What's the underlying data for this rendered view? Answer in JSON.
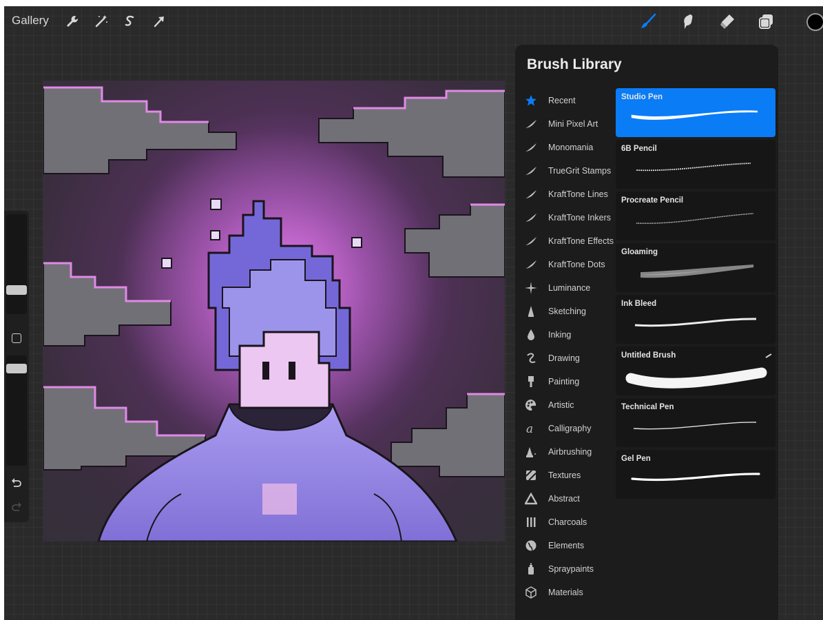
{
  "topbar": {
    "gallery_label": "Gallery",
    "left_tools": [
      {
        "name": "wrench-icon"
      },
      {
        "name": "magic-wand-icon"
      },
      {
        "name": "selection-icon"
      },
      {
        "name": "transform-arrow-icon"
      }
    ],
    "right_tools": [
      {
        "name": "brush-icon",
        "active": true
      },
      {
        "name": "smudge-icon"
      },
      {
        "name": "eraser-icon"
      },
      {
        "name": "layers-icon"
      }
    ],
    "current_color": "#000000",
    "accent_color": "#0a7cf6"
  },
  "sidebar": {
    "brush_size_level": 0.25,
    "opacity_level": 0.65,
    "items": [
      {
        "name": "brush-size-slider"
      },
      {
        "name": "modifier-button"
      },
      {
        "name": "opacity-slider"
      },
      {
        "name": "undo-icon"
      },
      {
        "name": "redo-icon"
      }
    ]
  },
  "brush_library": {
    "title": "Brush Library",
    "sets": [
      {
        "label": "Recent",
        "icon": "star-icon"
      },
      {
        "label": "Mini Pixel Art",
        "icon": "brush-stroke-icon"
      },
      {
        "label": "Monomania",
        "icon": "brush-stroke-icon"
      },
      {
        "label": "TrueGrit Stamps",
        "icon": "brush-stroke-icon"
      },
      {
        "label": "KraftTone Lines",
        "icon": "brush-stroke-icon"
      },
      {
        "label": "KraftTone Inkers",
        "icon": "brush-stroke-icon"
      },
      {
        "label": "KraftTone Effects",
        "icon": "brush-stroke-icon"
      },
      {
        "label": "KraftTone Dots",
        "icon": "brush-stroke-icon"
      },
      {
        "label": "Luminance",
        "icon": "sparkle-icon"
      },
      {
        "label": "Sketching",
        "icon": "pencil-tip-icon"
      },
      {
        "label": "Inking",
        "icon": "ink-drop-icon"
      },
      {
        "label": "Drawing",
        "icon": "squiggle-icon"
      },
      {
        "label": "Painting",
        "icon": "paintbrush-icon"
      },
      {
        "label": "Artistic",
        "icon": "palette-icon"
      },
      {
        "label": "Calligraphy",
        "icon": "calligraphy-icon"
      },
      {
        "label": "Airbrushing",
        "icon": "airbrush-icon"
      },
      {
        "label": "Textures",
        "icon": "texture-icon"
      },
      {
        "label": "Abstract",
        "icon": "triangle-icon"
      },
      {
        "label": "Charcoals",
        "icon": "charcoal-icon"
      },
      {
        "label": "Elements",
        "icon": "globe-icon"
      },
      {
        "label": "Spraypaints",
        "icon": "spray-can-icon"
      },
      {
        "label": "Materials",
        "icon": "cube-icon"
      }
    ],
    "brushes": [
      {
        "name": "Studio Pen",
        "selected": true
      },
      {
        "name": "6B Pencil",
        "selected": false
      },
      {
        "name": "Procreate Pencil",
        "selected": false
      },
      {
        "name": "Gloaming",
        "selected": false
      },
      {
        "name": "Ink Bleed",
        "selected": false
      },
      {
        "name": "Untitled Brush",
        "selected": false
      },
      {
        "name": "Technical Pen",
        "selected": false
      },
      {
        "name": "Gel Pen",
        "selected": false
      }
    ]
  }
}
